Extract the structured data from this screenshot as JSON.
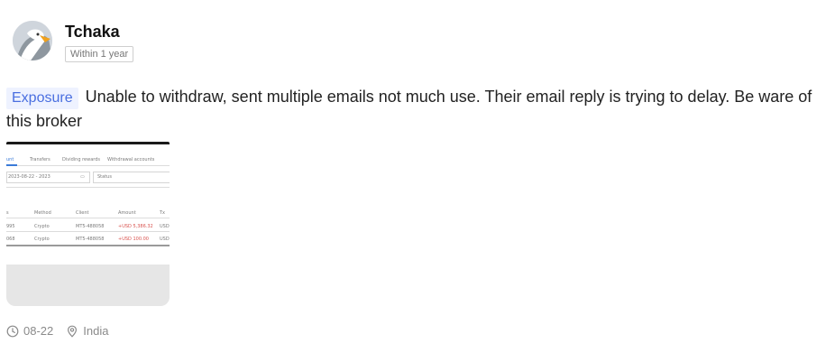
{
  "post": {
    "author": "Tchaka",
    "time_badge": "Within 1 year",
    "tag": "Exposure",
    "text": "Unable to withdraw, sent multiple emails not much use. Their email reply is trying to delay. Be ware of this broker",
    "date": "08-22",
    "location": "India"
  },
  "attachment": {
    "tabs": [
      "unt",
      "Transfers",
      "Dividing rewards",
      "Withdrawal accounts"
    ],
    "filter": {
      "date": "2023-08-22 - 2023",
      "status": "Status"
    },
    "columns": [
      "s",
      "Method",
      "Client",
      "Amount",
      "Tx"
    ],
    "rows": [
      {
        "id": "995",
        "method": "Crypto",
        "client": "MT5-488058",
        "amount": "+USD 5,386.32",
        "tx": "USD"
      },
      {
        "id": "068",
        "method": "Crypto",
        "client": "MT5-488058",
        "amount": "+USD 100.00",
        "tx": "USD"
      }
    ]
  },
  "icons": {
    "avatar": "eagle-avatar",
    "date": "clock-icon",
    "location": "location-pin-icon"
  },
  "colors": {
    "tag_bg": "#eef2ff",
    "tag_text": "#4a6fe0",
    "amount_red": "#d9534f"
  }
}
